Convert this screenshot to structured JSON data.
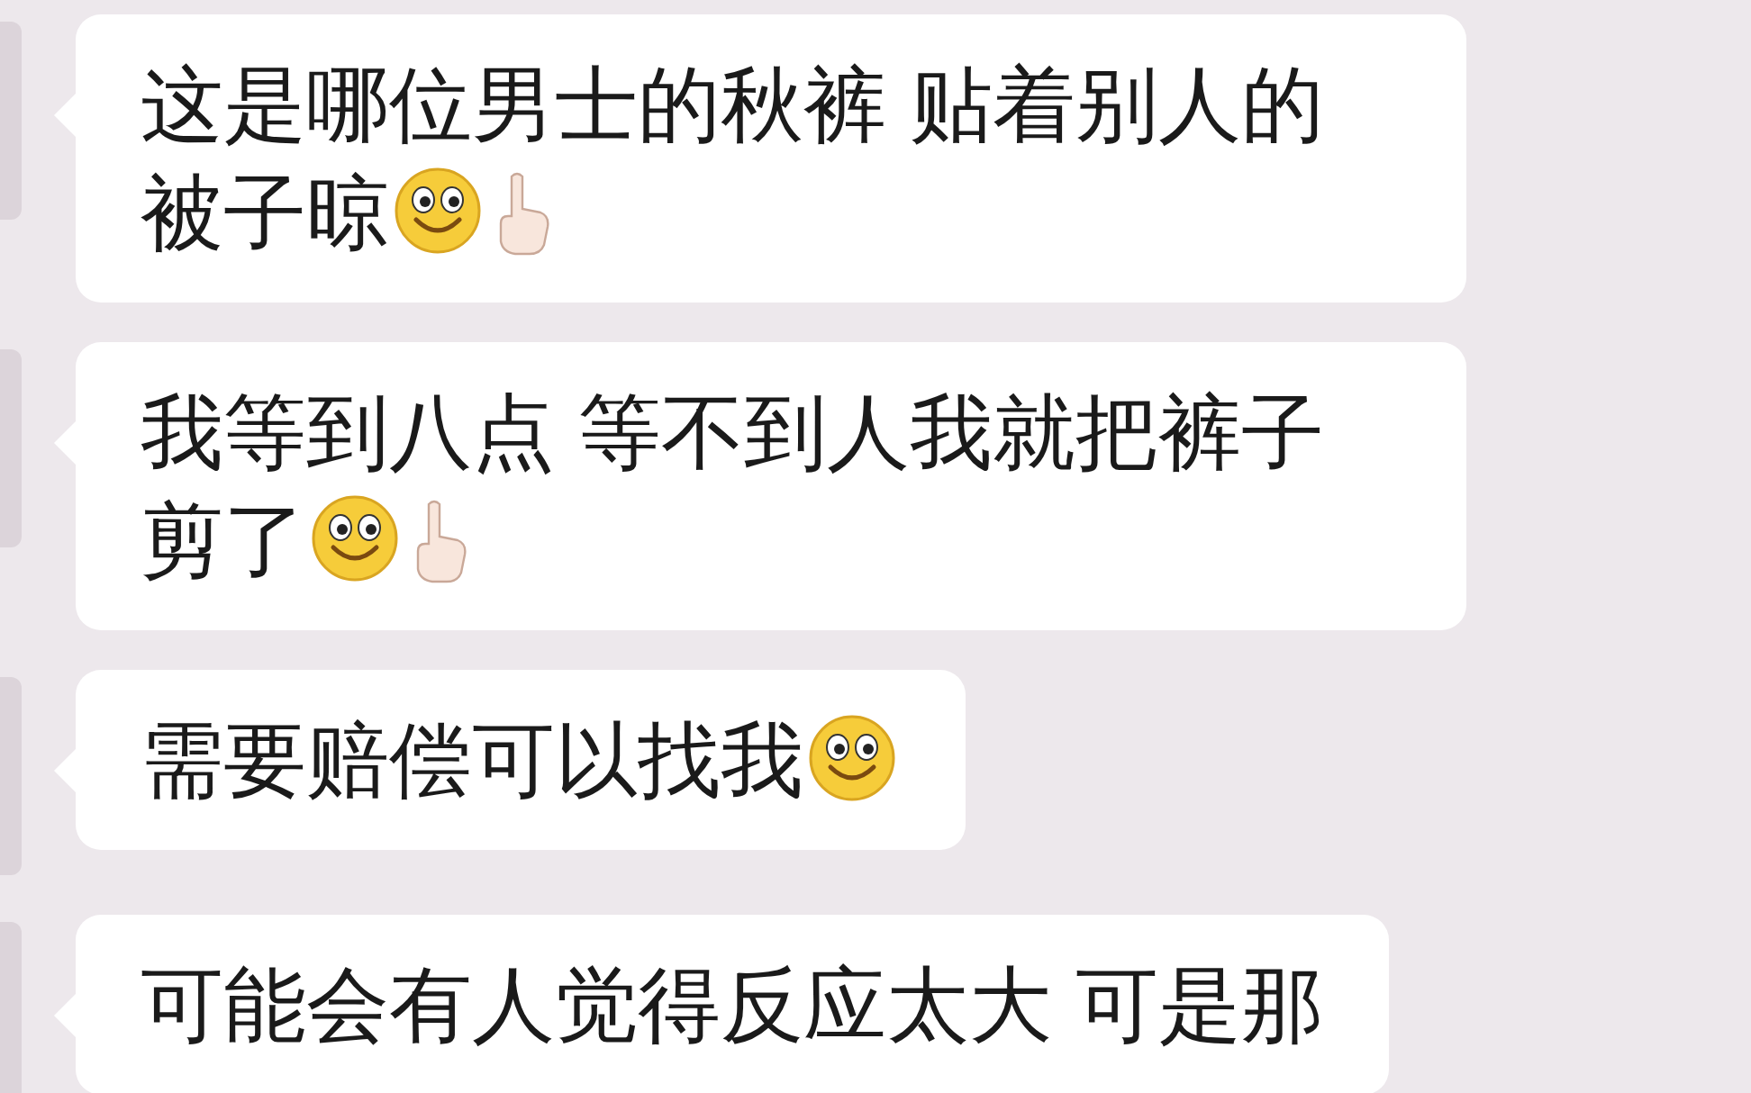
{
  "messages": [
    {
      "segments": [
        {
          "kind": "text",
          "text": "这是哪位男士的秋裤 贴着别人的被子晾"
        },
        {
          "kind": "smile"
        },
        {
          "kind": "point_up"
        }
      ]
    },
    {
      "segments": [
        {
          "kind": "text",
          "text": "我等到八点 等不到人我就把裤子剪了"
        },
        {
          "kind": "smile"
        },
        {
          "kind": "point_up"
        }
      ]
    },
    {
      "segments": [
        {
          "kind": "text",
          "text": "需要赔偿可以找我"
        },
        {
          "kind": "smile"
        }
      ]
    },
    {
      "segments": [
        {
          "kind": "text",
          "text": "可能会有人觉得反应太大 可是那"
        }
      ]
    }
  ]
}
